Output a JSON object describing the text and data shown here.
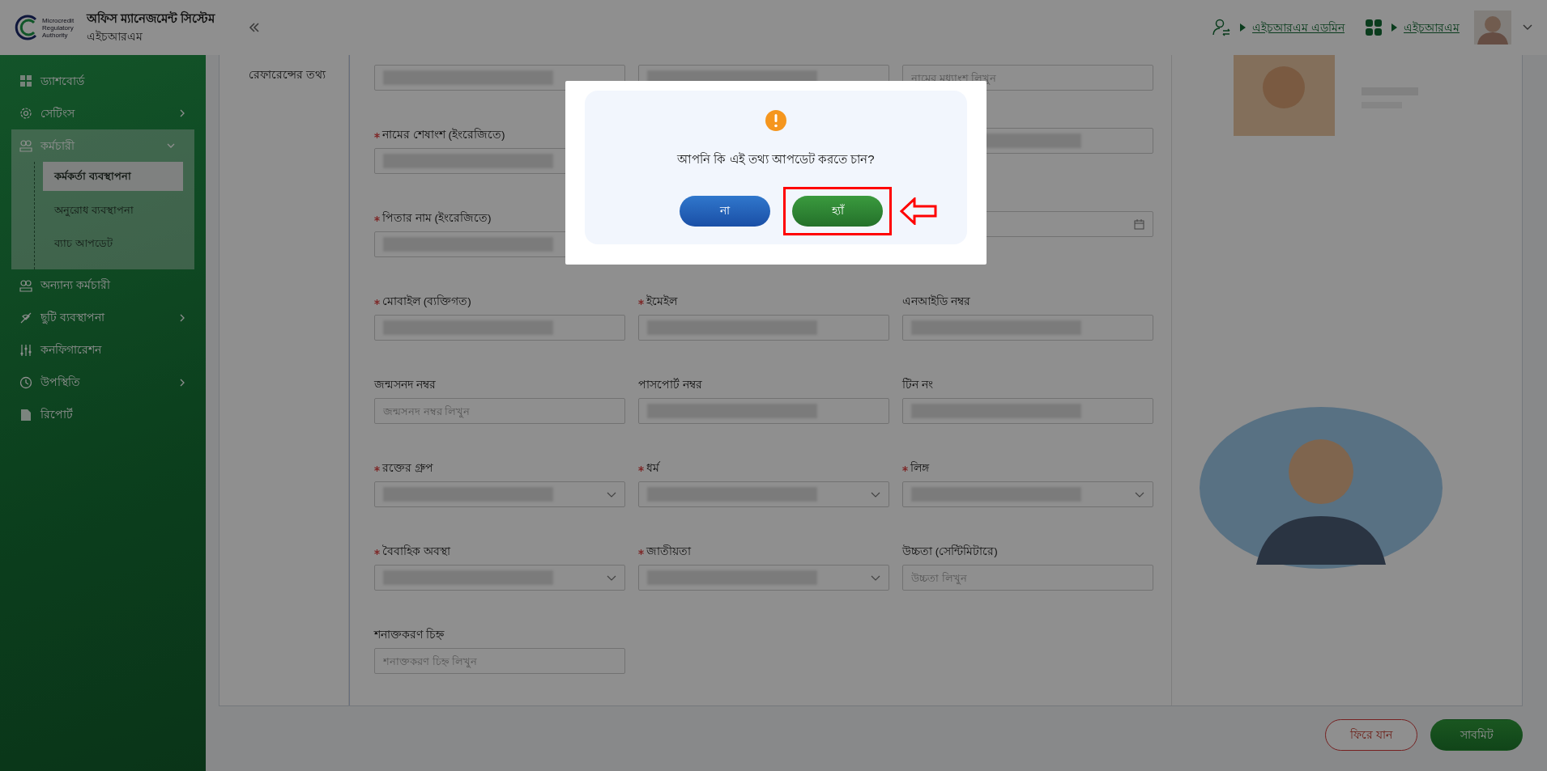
{
  "header": {
    "logo_lines": [
      "Microcredit",
      "Regulatory",
      "Authority"
    ],
    "title": "অফিস ম্যানেজমেন্ট সিস্টেম",
    "subtitle": "এইচআরএম",
    "role_link": "এইচআরএম এডমিন",
    "module_link": "এইচআরএম"
  },
  "sidebar": {
    "items": [
      {
        "label": "ড্যাশবোর্ড",
        "expandable": false,
        "expanded": false
      },
      {
        "label": "সেটিংস",
        "expandable": true,
        "expanded": false
      },
      {
        "label": "কর্মচারী",
        "expandable": true,
        "expanded": true,
        "children": [
          {
            "label": "কর্মকর্তা ব্যবস্থাপনা",
            "selected": true
          },
          {
            "label": "অনুরোধ ব্যবস্থাপনা",
            "selected": false
          },
          {
            "label": "ব্যাচ আপডেট",
            "selected": false
          }
        ]
      },
      {
        "label": "অন্যান্য কর্মচারী",
        "expandable": false,
        "expanded": false
      },
      {
        "label": "ছুটি ব্যবস্থাপনা",
        "expandable": true,
        "expanded": false
      },
      {
        "label": "কনফিগারেশন",
        "expandable": false,
        "expanded": false
      },
      {
        "label": "উপস্থিতি",
        "expandable": true,
        "expanded": false
      },
      {
        "label": "রিপোর্ট",
        "expandable": false,
        "expanded": false
      }
    ]
  },
  "section_label": "রেফারেন্সের তথ্য",
  "form_rows": [
    {
      "fields": [
        {
          "kind": "text",
          "redacted": true
        },
        {
          "kind": "text",
          "redacted": true
        },
        {
          "kind": "text",
          "placeholder": "নামের মধ্যাংশ লিখুন"
        }
      ]
    },
    {
      "fields": [
        {
          "kind": "text",
          "label": "নামের শেষাংশ (ইংরেজিতে)",
          "required": true,
          "redacted": true
        },
        {
          "kind": "covered"
        },
        {
          "kind": "text",
          "redacted": true
        }
      ]
    },
    {
      "fields": [
        {
          "kind": "text",
          "label": "পিতার নাম (ইংরেজিতে)",
          "required": true,
          "redacted": true
        },
        {
          "kind": "covered"
        },
        {
          "kind": "date"
        }
      ]
    },
    {
      "fields": [
        {
          "kind": "text",
          "label": "মোবাইল (ব্যক্তিগত)",
          "required": true,
          "redacted": true
        },
        {
          "kind": "text",
          "label": "ইমেইল",
          "required": true,
          "redacted": true
        },
        {
          "kind": "text",
          "label": "এনআইডি নম্বর",
          "required": false,
          "redacted": true
        }
      ]
    },
    {
      "fields": [
        {
          "kind": "text",
          "label": "জন্মসনদ নম্বর",
          "required": false,
          "placeholder": "জন্মসনদ নম্বর লিখুন"
        },
        {
          "kind": "text",
          "label": "পাসপোর্ট নম্বর",
          "required": false,
          "redacted": true
        },
        {
          "kind": "text",
          "label": "টিন নং",
          "required": false,
          "redacted": true
        }
      ]
    },
    {
      "fields": [
        {
          "kind": "select",
          "label": "রক্তের গ্রুপ",
          "required": true,
          "redacted": true
        },
        {
          "kind": "select",
          "label": "ধর্ম",
          "required": true,
          "redacted": true
        },
        {
          "kind": "select",
          "label": "লিঙ্গ",
          "required": true,
          "redacted": true
        }
      ]
    },
    {
      "fields": [
        {
          "kind": "select",
          "label": "বৈবাহিক অবস্থা",
          "required": true,
          "redacted": true
        },
        {
          "kind": "select",
          "label": "জাতীয়তা",
          "required": true,
          "redacted": true
        },
        {
          "kind": "text",
          "label": "উচ্চতা (সেন্টিমিটারে)",
          "required": false,
          "placeholder": "উচ্চতা লিখুন"
        }
      ]
    },
    {
      "fields": [
        {
          "kind": "text",
          "label": "শনাক্তকরণ চিহ্ন",
          "required": false,
          "placeholder": "শনাক্তকরণ চিহ্ন লিখুন"
        }
      ]
    }
  ],
  "actions": [
    {
      "label": "ফিরে যান",
      "kind": "outline"
    },
    {
      "label": "সাবমিট",
      "kind": "primary"
    }
  ],
  "dialog": {
    "message": "আপনি কি এই তথ্য আপডেট করতে চান?",
    "buttons": [
      {
        "label": "না",
        "kind": "cancel",
        "highlighted": false
      },
      {
        "label": "হ্যাঁ",
        "kind": "confirm",
        "highlighted": true
      }
    ]
  }
}
